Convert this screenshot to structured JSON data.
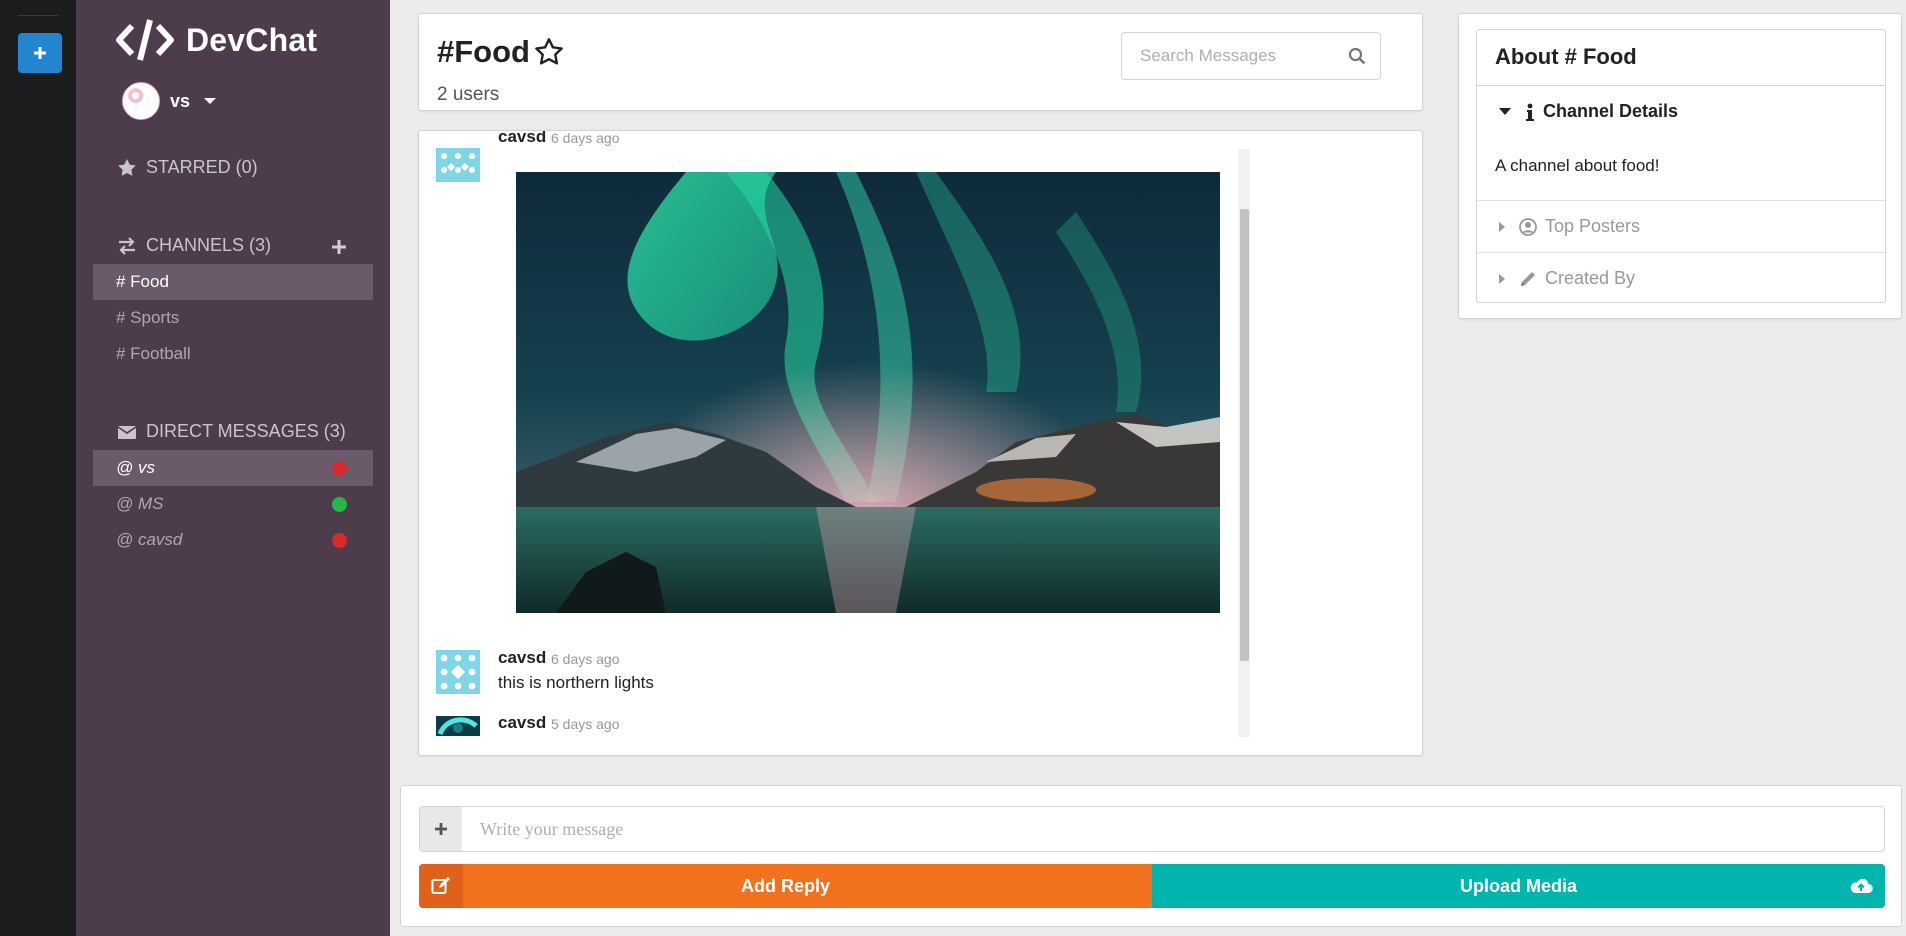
{
  "rail": {
    "add_team_icon": "plus-icon"
  },
  "sidebar": {
    "brand": "DevChat",
    "user": {
      "name": "vs"
    },
    "starred": {
      "label": "STARRED (0)"
    },
    "channels": {
      "label": "CHANNELS (3)",
      "items": [
        {
          "label": "# Food",
          "active": true
        },
        {
          "label": "# Sports",
          "active": false
        },
        {
          "label": "# Football",
          "active": false
        }
      ]
    },
    "direct_messages": {
      "label": "DIRECT MESSAGES (3)",
      "items": [
        {
          "label": "@ vs",
          "status": "offline",
          "status_color": "#db2828"
        },
        {
          "label": "@ MS",
          "status": "online",
          "status_color": "#21ba45"
        },
        {
          "label": "@ cavsd",
          "status": "offline",
          "status_color": "#db2828"
        }
      ]
    },
    "colors": {
      "background": "#4c3c4c",
      "active_item": "#6a5a6a"
    }
  },
  "header": {
    "channel_name": "#Food",
    "user_count": "2 users",
    "search_placeholder": "Search Messages"
  },
  "messages": [
    {
      "author": "cavsd",
      "time": "6 days ago",
      "type": "image",
      "image_description": "northern lights"
    },
    {
      "author": "cavsd",
      "time": "6 days ago",
      "text": "this is northern lights"
    },
    {
      "author": "cavsd",
      "time": "5 days ago",
      "type": "image"
    }
  ],
  "about": {
    "title": "About # Food",
    "sections": [
      {
        "label": "Channel Details",
        "open": true,
        "body": "A channel about food!",
        "icon": "info-icon"
      },
      {
        "label": "Top Posters",
        "open": false,
        "icon": "user-circle-icon"
      },
      {
        "label": "Created By",
        "open": false,
        "icon": "pencil-icon"
      }
    ]
  },
  "composer": {
    "placeholder": "Write your message",
    "add_reply": "Add Reply",
    "upload_media": "Upload Media",
    "colors": {
      "reply": "#f2711c",
      "upload": "#00b5ad"
    }
  }
}
